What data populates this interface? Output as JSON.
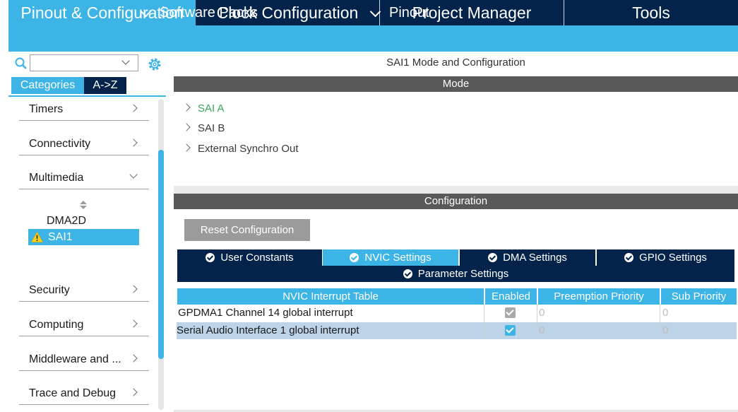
{
  "top_tabs": [
    "Pinout & Configuration",
    "Clock Configuration",
    "Project Manager",
    "Tools"
  ],
  "subbar": {
    "software_packs": "Software Packs",
    "pinout": "Pinout"
  },
  "search": {
    "value": ""
  },
  "category_tabs": [
    "Categories",
    "A->Z"
  ],
  "categories": {
    "timers": "Timers",
    "connectivity": "Connectivity",
    "multimedia": "Multimedia",
    "multimedia_items": [
      "DMA2D",
      "SAI1"
    ],
    "security": "Security",
    "computing": "Computing",
    "middleware": "Middleware and ...",
    "trace": "Trace and Debug"
  },
  "panel_title": "SAI1 Mode and Configuration",
  "mode": {
    "header": "Mode",
    "items": [
      "SAI A",
      "SAI B",
      "External Synchro Out"
    ]
  },
  "configuration": {
    "header": "Configuration",
    "reset_button": "Reset Configuration",
    "tabs": [
      "User Constants",
      "NVIC Settings",
      "DMA Settings",
      "GPIO Settings"
    ],
    "param_tab": "Parameter Settings",
    "table": {
      "headers": [
        "NVIC Interrupt Table",
        "Enabled",
        "Preemption Priority",
        "Sub Priority"
      ],
      "rows": [
        {
          "name": "GPDMA1 Channel 14 global interrupt",
          "enabled": true,
          "enabled_editable": false,
          "preemption": "0",
          "sub": "0"
        },
        {
          "name": "Serial Audio Interface 1 global interrupt",
          "enabled": true,
          "enabled_editable": true,
          "preemption": "0",
          "sub": "0"
        }
      ]
    }
  },
  "colors": {
    "navy": "#03234b",
    "accent": "#3cb4e6",
    "green_text": "#3aa661"
  }
}
